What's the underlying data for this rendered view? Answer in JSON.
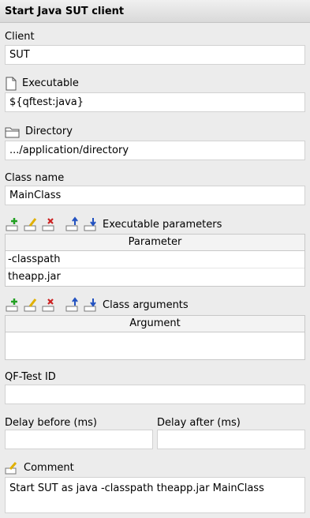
{
  "header": {
    "title": "Start Java SUT client"
  },
  "client": {
    "label": "Client",
    "value": "SUT"
  },
  "executable": {
    "label": "Executable",
    "value": "${qftest:java}",
    "icon": "document-icon"
  },
  "directory": {
    "label": "Directory",
    "value": ".../application/directory",
    "icon": "folder-icon"
  },
  "class_name": {
    "label": "Class name",
    "value": "MainClass"
  },
  "exec_params": {
    "toolbar_label": "Executable parameters",
    "column": "Parameter",
    "rows": [
      "-classpath",
      "theapp.jar"
    ]
  },
  "class_args": {
    "toolbar_label": "Class arguments",
    "column": "Argument",
    "rows": []
  },
  "qftest_id": {
    "label": "QF-Test ID",
    "value": ""
  },
  "delay_before": {
    "label": "Delay before (ms)",
    "value": ""
  },
  "delay_after": {
    "label": "Delay after (ms)",
    "value": ""
  },
  "comment": {
    "label": "Comment",
    "value": "Start SUT as java -classpath theapp.jar MainClass",
    "icon": "edit-comment-icon"
  },
  "toolbar_icons": [
    "add-icon",
    "edit-icon",
    "delete-icon",
    "move-up-icon",
    "move-down-icon"
  ],
  "colors": {
    "add": "#22a022",
    "edit": "#e0b000",
    "delete": "#cc2020",
    "move": "#2050c0"
  }
}
